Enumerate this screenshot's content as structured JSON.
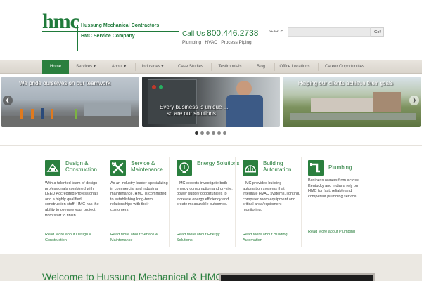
{
  "brand": {
    "logo_word": "hmc",
    "company_line1": "Hussung Mechanical Contractors",
    "company_line2": "HMC Service Company",
    "brand_green": "#2a7f3e"
  },
  "header": {
    "call_label": "Call Us",
    "phone": "800.446.2738",
    "services_line": "Plumbing | HVAC | Process Piping"
  },
  "search": {
    "label": "SEARCH",
    "placeholder": "",
    "button_label": "Go!"
  },
  "nav": {
    "items": [
      {
        "label": "Home"
      },
      {
        "label": "Services ▾"
      },
      {
        "label": "About ▾"
      },
      {
        "label": "Industries ▾"
      },
      {
        "label": "Case Studies"
      },
      {
        "label": "Testimonials"
      },
      {
        "label": "Blog"
      },
      {
        "label": "Office Locations"
      },
      {
        "label": "Career Opportunities"
      }
    ]
  },
  "slider": {
    "slides": [
      {
        "caption": "We pride ourselves on our teamwork"
      },
      {
        "caption_line1": "Every business is unique ...",
        "caption_line2": "so are our solutions"
      },
      {
        "caption": "Helping our clients achieve their goals"
      }
    ],
    "prev_icon": "arrow-left-icon",
    "next_icon": "arrow-right-icon",
    "prev_glyph": "❮",
    "next_glyph": "❯",
    "dot_count": 6,
    "active_dot": 1
  },
  "services": [
    {
      "icon": "design-construction-icon",
      "title": "Design & Construction",
      "text": "With a talented team of design professionals combined with LEED Accredited Professionals and a highly qualified construction staff, HMC has the ability to oversee your project from start to finish.",
      "link": "Read More about Design & Construction"
    },
    {
      "icon": "wrench-tools-icon",
      "title": "Service & Maintenance",
      "text": "As an industry leader specializing in commercial and industrial maintenance, HMC is committed to establishing long-term relationships with their customers.",
      "link": "Read More about Service & Maintenance"
    },
    {
      "icon": "lightbulb-icon",
      "title": "Energy Solutions",
      "text": "HMC experts investigate both energy consumption and on-site, power supply opportunities to increase energy efficiency and create measurable outcomes.",
      "link": "Read More about Energy Solutions"
    },
    {
      "icon": "building-dome-icon",
      "title": "Building Automation",
      "text": "HMC provides building automation systems that integrate HVAC systems, lighting, computer room equipment and critical area/equipment monitoring.",
      "link": "Read More about Building Automation"
    },
    {
      "icon": "pipe-icon",
      "title": "Plumbing",
      "text": "Business owners from across Kentucky and Indiana rely on HMC for fast, reliable and competent plumbing service.",
      "link": "Read More about Plumbing"
    }
  ],
  "welcome": {
    "heading": "Welcome to Hussung Mechanical & HMC"
  }
}
